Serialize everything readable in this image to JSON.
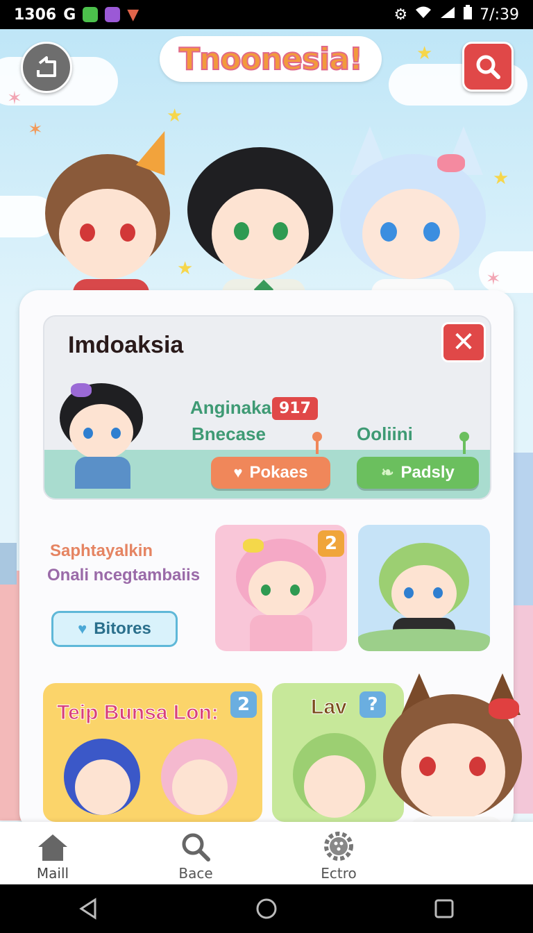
{
  "status_bar": {
    "time_left": "1306",
    "time_right": "7/:39"
  },
  "header": {
    "app_title": "Tnoonesia!",
    "back_icon": "back-arrow-icon",
    "search_icon": "search-icon"
  },
  "profile": {
    "name": "Imdoaksia",
    "stat1_label": "Anginaka",
    "stat1_count": "917",
    "stat2_label": "Bnecase",
    "stat3_label": "Ooliini",
    "button_left": "Pokaes",
    "button_right": "Padsly"
  },
  "promo": {
    "title": "Saphtayalkin",
    "subtitle": "Onali ncegtambaiis",
    "button": "Bitores"
  },
  "thumbnails": {
    "thumb1_badge": "2"
  },
  "games": [
    {
      "title": "Teip Bunsa Lon:",
      "badge": "2"
    },
    {
      "title": "Lav",
      "badge": "?"
    }
  ],
  "bottom_nav": {
    "items": [
      {
        "label": "Maill",
        "icon": "home-icon"
      },
      {
        "label": "Bace",
        "icon": "search-icon"
      },
      {
        "label": "Ectro",
        "icon": "settings-icon"
      }
    ]
  },
  "colors": {
    "accent_red": "#e04848",
    "accent_orange": "#f0875a",
    "accent_green": "#6bbf5e",
    "title_orange": "#f29a3c"
  }
}
